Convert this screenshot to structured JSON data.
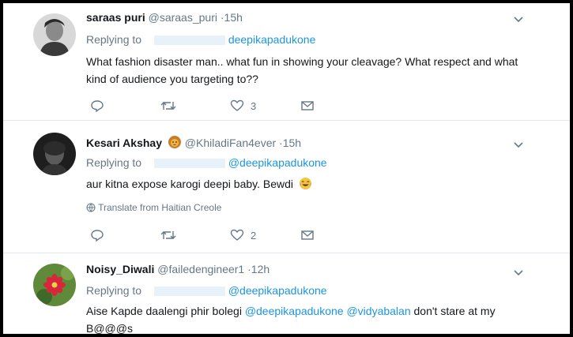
{
  "tweets": [
    {
      "name": "saraas puri",
      "handle": "@saraas_puri",
      "time": "·15h",
      "replying_to_label": "Replying to",
      "reply_mentions": [
        "deepikapadukone"
      ],
      "text": "What fashion disaster man.. what fun in showing your cleavage? What respect and what kind of audience you targeting to??",
      "likes": "3"
    },
    {
      "name": "Kesari Akshay",
      "handle": "@KhiladiFan4ever",
      "time": "·15h",
      "replying_to_label": "Replying to",
      "reply_mentions": [
        "@deepikapadukone"
      ],
      "text": "aur kitna expose karogi deepi baby.  Bewdi",
      "translate": "Translate from Haitian Creole",
      "likes": "2"
    },
    {
      "name": "Noisy_Diwali",
      "handle": "@failedengineer1",
      "time": "·12h",
      "replying_to_label": "Replying to",
      "reply_mentions": [
        "@deepikapadukone"
      ],
      "text_parts": [
        "Aise Kapde daalengi phir bolegi ",
        "@deepikapadukone",
        " ",
        "@vidyabalan",
        " don't stare at my B@@@s"
      ]
    }
  ],
  "colors": {
    "link": "#1b95e0",
    "secondary": "#657786",
    "text": "#14171a"
  },
  "icons": [
    "reply-icon",
    "retweet-icon",
    "like-icon",
    "message-icon",
    "chevron-down-icon",
    "globe-icon",
    "lion-emoji-icon",
    "laughing-emoji-icon"
  ]
}
